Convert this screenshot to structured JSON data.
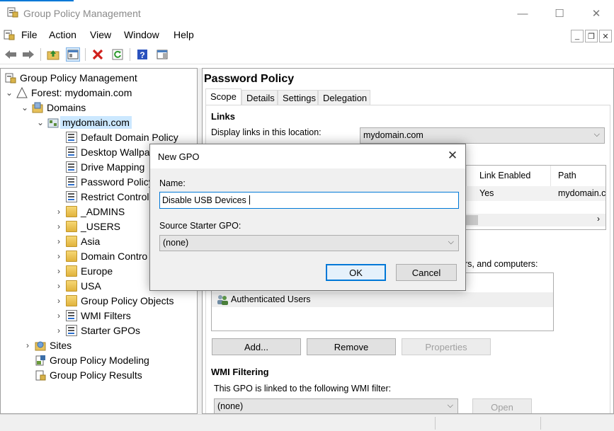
{
  "window": {
    "title": "Group Policy Management",
    "minimize_icon": "—",
    "maximize_icon": "☐",
    "close_icon": "✕"
  },
  "menu": [
    "File",
    "Action",
    "View",
    "Window",
    "Help"
  ],
  "tree": {
    "root": "Group Policy Management",
    "forest": "Forest: mydomain.com",
    "domains": "Domains",
    "domain": "mydomain.com",
    "gpo_links": [
      "Default Domain Policy",
      "Desktop Wallpa",
      "Drive Mapping",
      "Password Policy",
      "Restrict Control"
    ],
    "ous": [
      "_ADMINS",
      "_USERS",
      "Asia",
      "Domain Contro",
      "Europe",
      "USA"
    ],
    "containers": [
      "Group Policy Objects",
      "WMI Filters",
      "Starter GPOs"
    ],
    "sites": "Sites",
    "modeling": "Group Policy Modeling",
    "results": "Group Policy Results"
  },
  "details": {
    "heading": "Password Policy",
    "tabs": [
      "Scope",
      "Details",
      "Settings",
      "Delegation"
    ],
    "links_title": "Links",
    "display_links_label": "Display links in this location:",
    "location_value": "mydomain.com",
    "links_columns": [
      "Link Enabled",
      "Path"
    ],
    "links_row": [
      "Yes",
      "mydomain.c"
    ],
    "filter_text_tail": "ers, and computers:",
    "security_filter_item": "Authenticated Users",
    "buttons": {
      "add": "Add...",
      "remove": "Remove",
      "properties": "Properties"
    },
    "wmi_title": "WMI Filtering",
    "wmi_label": "This GPO is linked to the following WMI filter:",
    "wmi_value": "(none)",
    "wmi_open": "Open"
  },
  "dialog": {
    "title": "New GPO",
    "name_label": "Name:",
    "name_value": "Disable USB Devices ",
    "source_label": "Source Starter GPO:",
    "source_value": "(none)",
    "ok": "OK",
    "cancel": "Cancel"
  }
}
